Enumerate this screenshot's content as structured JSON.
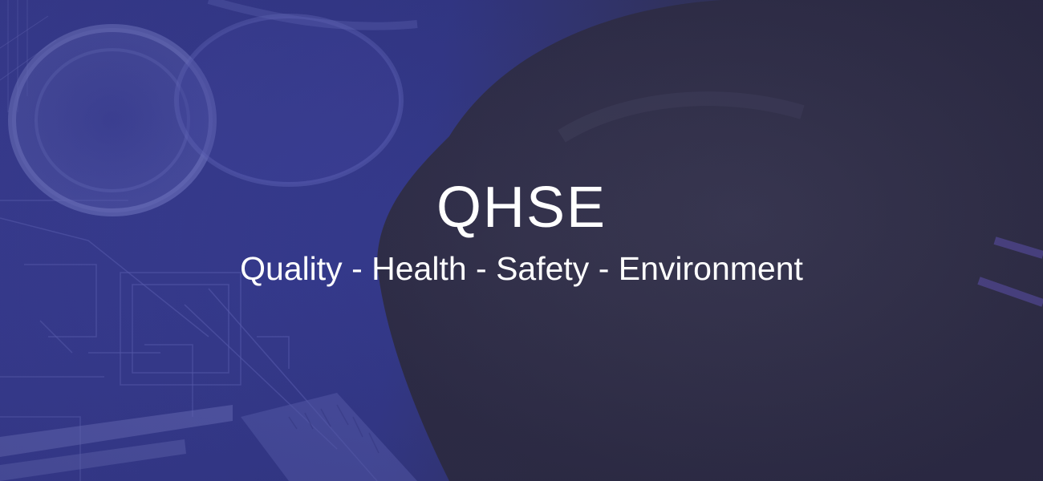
{
  "hero": {
    "title": "QHSE",
    "subtitle": "Quality - Health - Safety - Environment",
    "background_image": "blueprints-with-hard-hat-photo",
    "overlay_color": "#3b3f97",
    "text_color": "#ffffff"
  }
}
